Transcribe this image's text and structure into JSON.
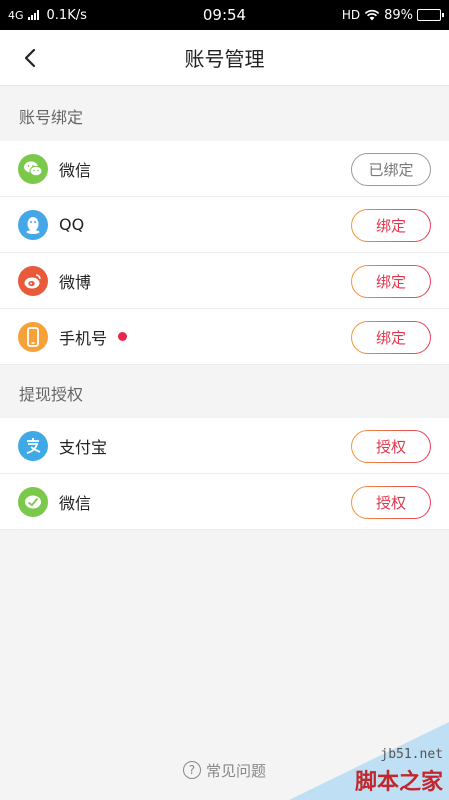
{
  "status_bar": {
    "network": "4G",
    "speed": "0.1K/s",
    "time": "09:54",
    "hd": "HD",
    "battery_text": "89%",
    "battery_level": 0.89
  },
  "nav": {
    "title": "账号管理",
    "back_icon": "chevron-left-icon"
  },
  "sections": {
    "binding_title": "账号绑定",
    "auth_title": "提现授权"
  },
  "binding_items": [
    {
      "label": "微信",
      "icon": "wechat-icon",
      "color": "#7bc94a",
      "button": "已绑定",
      "bound": true
    },
    {
      "label": "QQ",
      "icon": "qq-icon",
      "color": "#45a6e8",
      "button": "绑定",
      "bound": false
    },
    {
      "label": "微博",
      "icon": "weibo-icon",
      "color": "#e85a3a",
      "button": "绑定",
      "bound": false
    },
    {
      "label": "手机号",
      "icon": "phone-icon",
      "color": "#f5a23a",
      "button": "绑定",
      "bound": false,
      "red_dot": true
    }
  ],
  "auth_items": [
    {
      "label": "支付宝",
      "icon": "alipay-icon",
      "color": "#3fa9e6",
      "button": "授权"
    },
    {
      "label": "微信",
      "icon": "wechat-pay-icon",
      "color": "#7bc94a",
      "button": "授权"
    }
  ],
  "footer": {
    "help_label": "常见问题",
    "help_icon": "question-circle-icon"
  },
  "watermark": {
    "url": "jb51.net",
    "name": "脚本之家"
  },
  "colors": {
    "accent_start": "#f29a3e",
    "accent_end": "#e33b58",
    "bound_border": "#9a9a9a",
    "red_dot": "#e8264e"
  }
}
